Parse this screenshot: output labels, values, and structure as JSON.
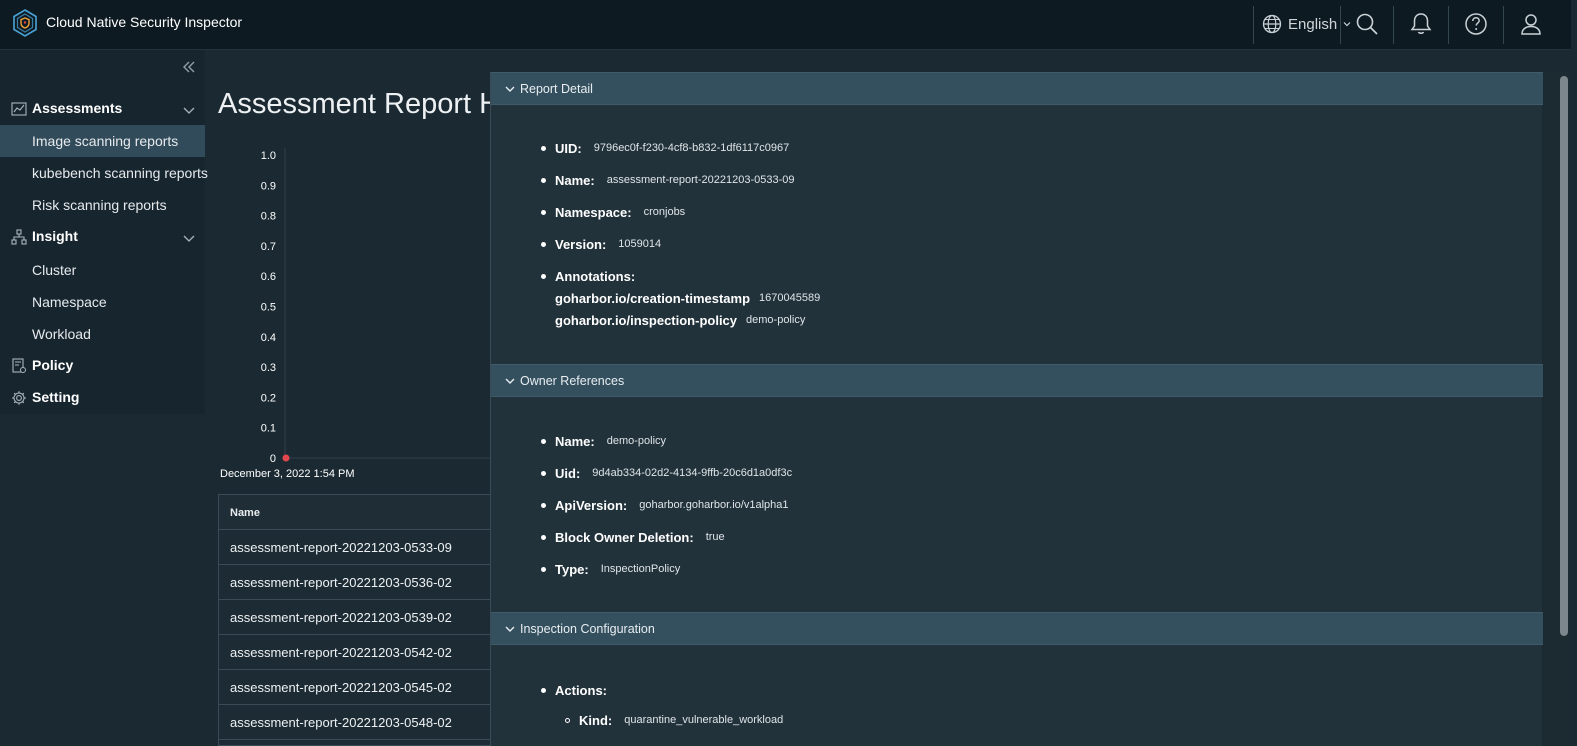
{
  "header": {
    "title": "Cloud Native Security Inspector",
    "language": "English"
  },
  "sidebar": {
    "groups": [
      {
        "label": "Assessments",
        "items": [
          "Image scanning reports",
          "kubebench scanning reports",
          "Risk scanning reports"
        ]
      },
      {
        "label": "Insight",
        "items": [
          "Cluster",
          "Namespace",
          "Workload"
        ]
      },
      {
        "label": "Policy"
      },
      {
        "label": "Setting"
      }
    ],
    "active_item": "Image scanning reports"
  },
  "main": {
    "title": "Assessment Report His",
    "table_header": "Name",
    "rows": [
      "assessment-report-20221203-0533-09",
      "assessment-report-20221203-0536-02",
      "assessment-report-20221203-0539-02",
      "assessment-report-20221203-0542-02",
      "assessment-report-20221203-0545-02",
      "assessment-report-20221203-0548-02"
    ]
  },
  "chart_data": {
    "type": "scatter",
    "yticks": [
      "1.0",
      "0.9",
      "0.8",
      "0.7",
      "0.6",
      "0.5",
      "0.4",
      "0.3",
      "0.2",
      "0.1",
      "0"
    ],
    "ylim": [
      0,
      1
    ],
    "x_label_first": "December 3, 2022 1:54 PM",
    "points": [
      {
        "x": "December 3, 2022 1:54 PM",
        "y": 0
      }
    ],
    "point_color": "#e0474c"
  },
  "detail": {
    "sections": {
      "report": "Report Detail",
      "owner": "Owner References",
      "inspection": "Inspection Configuration"
    },
    "report": {
      "uid_label": "UID:",
      "uid": "9796ec0f-f230-4cf8-b832-1df6117c0967",
      "name_label": "Name:",
      "name": "assessment-report-20221203-0533-09",
      "namespace_label": "Namespace:",
      "namespace": "cronjobs",
      "version_label": "Version:",
      "version": "1059014",
      "annotations_label": "Annotations:",
      "ann1_key": "goharbor.io/creation-timestamp",
      "ann1_val": "1670045589",
      "ann2_key": "goharbor.io/inspection-policy",
      "ann2_val": "demo-policy"
    },
    "owner": {
      "name_label": "Name:",
      "name": "demo-policy",
      "uid_label": "Uid:",
      "uid": "9d4ab334-02d2-4134-9ffb-20c6d1a0df3c",
      "api_label": "ApiVersion:",
      "api": "goharbor.goharbor.io/v1alpha1",
      "block_label": "Block Owner Deletion:",
      "block": "true",
      "type_label": "Type:",
      "type": "InspectionPolicy"
    },
    "inspection": {
      "actions_label": "Actions:",
      "kind_label": "Kind:",
      "kind": "quarantine_vulnerable_workload"
    }
  }
}
